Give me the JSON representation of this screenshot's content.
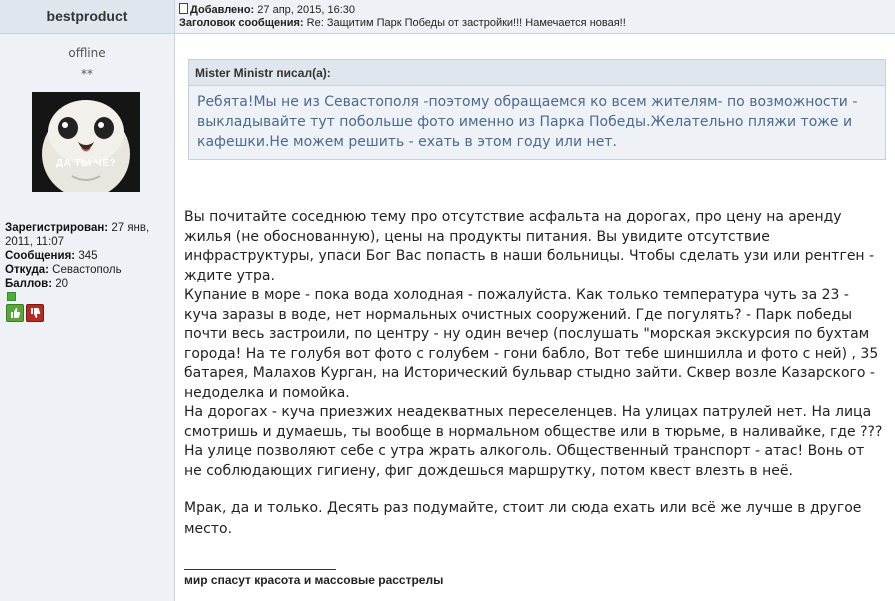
{
  "author": {
    "name": "bestproduct",
    "status": "offline",
    "rank": "**",
    "avatar_caption": "ДА ТЫ ЧЁ?",
    "registered_label": "Зарегистрирован:",
    "registered_value": "27 янв, 2011, 11:07",
    "posts_label": "Сообщения:",
    "posts_value": "345",
    "from_label": "Откуда:",
    "from_value": "Севастополь",
    "points_label": "Баллов:",
    "points_value": "20"
  },
  "post": {
    "added_label": "Добавлено:",
    "added_value": "27 апр, 2015, 16:30",
    "subject_label": "Заголовок сообщения:",
    "subject_value": "Re: Защитим Парк Победы от застройки!!! Намечается новая!!"
  },
  "quote": {
    "title": "Mister Ministr писал(а):",
    "text": "Ребята!Мы не из Севастополя -поэтому обращаемся ко всем жителям- по возможности - выкладывайте тут побольше фото именно из Парка Победы.Желательно пляжи тоже и кафешки.Не можем решить - ехать в этом году или нет."
  },
  "body": {
    "paragraphs": [
      "Вы почитайте соседнюю тему про отсутствие асфальта на дорогах, про цену на аренду жилья (не обоснованную), цены на продукты питания. Вы увидите отсутствие инфраструктуры, упаси Бог Вас попасть в наши больницы. Чтобы сделать узи или рентген - ждите утра.",
      "Купание в море - пока вода холодная - пожалуйста. Как только температура чуть за 23 - куча заразы в воде, нет нормальных очистных сооружений. Где погулять? - Парк победы почти весь застроили, по центру - ну один вечер (послушать \"морская экскурсия по бухтам города! На те голубя вот фото с голубем - гони бабло, Вот тебе шиншилла и фото с ней) , 35 батарея, Малахов Курган, на Исторический бульвар стыдно зайти. Сквер возле Казарского - недоделка и помойка.",
      "На дорогах - куча приезжих неадекватных переселенцев. На улицах патрулей нет. На лица смотришь и думаешь, ты вообще в нормальном обществе или в тюрьме, в наливайке, где ??? На улице позволяют себе с утра жрать алкоголь. Общественный транспорт - атас! Вонь от не соблюдающих гигиену, фиг дождешься маршрутку, потом квест влезть в неё."
    ],
    "closing": "Мрак, да и только. Десять раз подумайте, стоит ли сюда ехать или всё же лучше в другое место."
  },
  "signature": "мир спасут красота и массовые расстрелы",
  "colors": {
    "panel_bg": "#eef2f6",
    "header_bg": "#dfe6ee",
    "border": "#c8d1da",
    "quote_text": "#4a6a90",
    "vote_up": "#5aa63a",
    "vote_down": "#b52a24",
    "online_dot": "#4caf3a"
  }
}
